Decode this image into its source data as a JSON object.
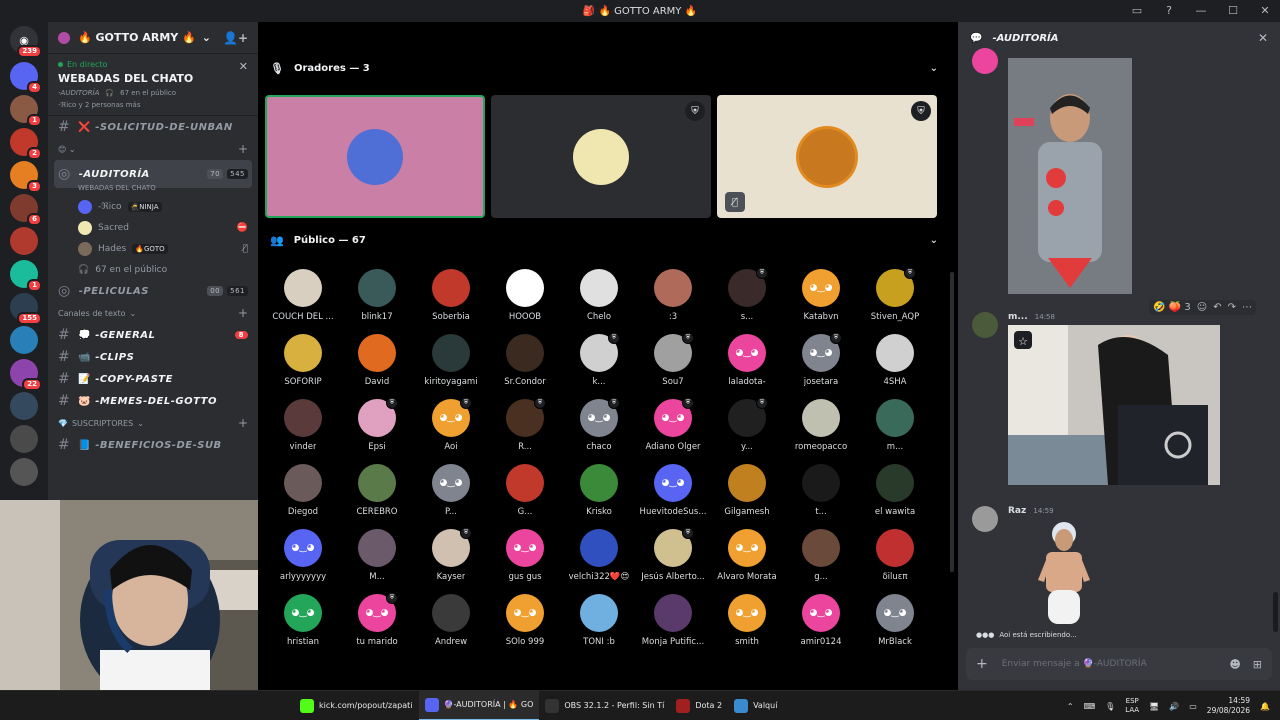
{
  "window": {
    "title": "🎒 🔥 GOTTO ARMY 🔥"
  },
  "rail": {
    "home_badge": "239",
    "servers": [
      {
        "color": "#5865f2",
        "badge": "4"
      },
      {
        "color": "#8a5a44",
        "badge": "1"
      },
      {
        "color": "#c0392b",
        "badge": "2"
      },
      {
        "color": "#e67e22",
        "badge": "3"
      },
      {
        "color": "#7f3b2e",
        "badge": "6"
      },
      {
        "color": "#b03a2e",
        "badge": ""
      },
      {
        "color": "#1abc9c",
        "badge": "1"
      },
      {
        "color": "#2c3e50",
        "badge": "155"
      },
      {
        "color": "#2980b9",
        "badge": ""
      },
      {
        "color": "#8e44ad",
        "badge": "22"
      },
      {
        "color": "#34495e",
        "badge": ""
      },
      {
        "color": "#4a4a4a",
        "badge": ""
      },
      {
        "color": "#555555",
        "badge": ""
      }
    ]
  },
  "sidebar": {
    "guild_name": "🔥 GOTTO ARMY 🔥",
    "live": {
      "status": "En directo",
      "title": "WEBADAS DEL CHATO",
      "channel": "-AUDITORÍA",
      "listeners": "67 en el público",
      "speakers": "-ℜico y 2 personas más"
    },
    "channels_top": [
      {
        "name": "-SOLICITUD-DE-UNBAN",
        "emoji": "❌"
      }
    ],
    "stage_channel": {
      "name": "-AUDITORÍA",
      "subtitle": "WEBADAS DEL CHATO",
      "count_a": "70",
      "count_b": "545"
    },
    "voice_users": [
      {
        "name": "-ℜico",
        "tag": "🥷NINJA",
        "color": "#5865f2"
      },
      {
        "name": "Sacred",
        "tag": "",
        "color": "#f0e6b0"
      },
      {
        "name": "Hades",
        "tag": "🔥GOTO",
        "color": "#7a6a5a"
      },
      {
        "name": "67 en el público",
        "tag": "",
        "color": ""
      }
    ],
    "channel_peliculas": {
      "name": "-PELICULAS",
      "count_a": "00",
      "count_b": "561"
    },
    "text_category": "Canales de texto",
    "text_channels": [
      {
        "name": "-GENERAL",
        "emoji": "💭",
        "badge": "8"
      },
      {
        "name": "-CLIPS",
        "emoji": "📹",
        "badge": ""
      },
      {
        "name": "-COPY-PASTE",
        "emoji": "📝",
        "badge": ""
      },
      {
        "name": "-MEMES-DEL-GOTTO",
        "emoji": "🐷",
        "badge": ""
      }
    ],
    "subs_category": "SUSCRIPTORES",
    "subs_channels": [
      {
        "name": "-BENEFICIOS-DE-SUB",
        "emoji": "📘"
      }
    ]
  },
  "stage": {
    "speakers_header": "Oradores — 3",
    "public_header": "Público — 67",
    "speakers": [
      {
        "bg": "#c97fa6",
        "avatar": "#4f6fd6",
        "shield": false,
        "muted": false,
        "selected": true
      },
      {
        "bg": "#2b2d31",
        "avatar": "#f0e6b0",
        "shield": true,
        "muted": false,
        "selected": false
      },
      {
        "bg": "#e9e1cf",
        "avatar": "#c8781f",
        "shield": true,
        "muted": true,
        "selected": false
      }
    ],
    "audience": [
      {
        "name": "COUCH DEL ...",
        "color": "#d8cfc0",
        "discord": false,
        "badge": false
      },
      {
        "name": "blink17",
        "color": "#3a5a5a",
        "discord": false,
        "badge": false
      },
      {
        "name": "Soberbia",
        "color": "#c0392b",
        "discord": false,
        "badge": false
      },
      {
        "name": "HOOOB",
        "color": "#ffffff",
        "discord": false,
        "badge": false
      },
      {
        "name": "Chelo",
        "color": "#e0e0e0",
        "discord": false,
        "badge": false
      },
      {
        "name": ":3",
        "color": "#b06a5a",
        "discord": false,
        "badge": false
      },
      {
        "name": "s...",
        "color": "#3a2a2a",
        "discord": false,
        "badge": true
      },
      {
        "name": "Katabvn",
        "color": "#f0a030",
        "discord": true,
        "badge": false
      },
      {
        "name": "Stiven_AQP",
        "color": "#c8a020",
        "discord": false,
        "badge": true
      },
      {
        "name": "SOFORIP",
        "color": "#d8b040",
        "discord": false,
        "badge": false
      },
      {
        "name": "David",
        "color": "#e06a20",
        "discord": false,
        "badge": false
      },
      {
        "name": "kiritoyagami",
        "color": "#2a3a3a",
        "discord": false,
        "badge": false
      },
      {
        "name": "Sr.Condor",
        "color": "#3a2a20",
        "discord": false,
        "badge": false
      },
      {
        "name": "k...",
        "color": "#d0d0d0",
        "discord": false,
        "badge": true
      },
      {
        "name": "Sou7",
        "color": "#a0a0a0",
        "discord": false,
        "badge": true
      },
      {
        "name": "laladota-",
        "color": "#eb459e",
        "discord": true,
        "badge": false
      },
      {
        "name": "josetara",
        "color": "#80848e",
        "discord": true,
        "badge": true
      },
      {
        "name": "4SHA",
        "color": "#d0d0d0",
        "discord": false,
        "badge": false
      },
      {
        "name": "vinder",
        "color": "#5a3a3a",
        "discord": false,
        "badge": false
      },
      {
        "name": "Epsi",
        "color": "#e0a0c0",
        "discord": false,
        "badge": true
      },
      {
        "name": "Aoi",
        "color": "#f0a030",
        "discord": true,
        "badge": true
      },
      {
        "name": "R...",
        "color": "#4a3020",
        "discord": false,
        "badge": true
      },
      {
        "name": "chaco",
        "color": "#80848e",
        "discord": true,
        "badge": true
      },
      {
        "name": "Adiano Olger",
        "color": "#eb459e",
        "discord": true,
        "badge": true
      },
      {
        "name": "y...",
        "color": "#202020",
        "discord": false,
        "badge": true
      },
      {
        "name": "romeopacco",
        "color": "#c0c0b0",
        "discord": false,
        "badge": false
      },
      {
        "name": "m...",
        "color": "#3a6a5a",
        "discord": false,
        "badge": false
      },
      {
        "name": "Diegod",
        "color": "#6a5a5a",
        "discord": false,
        "badge": false
      },
      {
        "name": "CEREBRO",
        "color": "#5a7a4a",
        "discord": false,
        "badge": false
      },
      {
        "name": "P...",
        "color": "#80848e",
        "discord": true,
        "badge": false
      },
      {
        "name": "G...",
        "color": "#c0392b",
        "discord": false,
        "badge": false
      },
      {
        "name": "Krisko",
        "color": "#3a8a3a",
        "discord": false,
        "badge": false
      },
      {
        "name": "HuevitodeSus...",
        "color": "#5865f2",
        "discord": true,
        "badge": false
      },
      {
        "name": "Gilgamesh",
        "color": "#c08020",
        "discord": false,
        "badge": false
      },
      {
        "name": "t...",
        "color": "#1a1a1a",
        "discord": false,
        "badge": false
      },
      {
        "name": "el wawita",
        "color": "#2a3a2a",
        "discord": false,
        "badge": false
      },
      {
        "name": "arlyyyyyyy",
        "color": "#5865f2",
        "discord": true,
        "badge": false
      },
      {
        "name": "M...",
        "color": "#6a5a6a",
        "discord": false,
        "badge": false
      },
      {
        "name": "Kayser",
        "color": "#d0c0b0",
        "discord": false,
        "badge": true
      },
      {
        "name": "gus gus",
        "color": "#eb459e",
        "discord": true,
        "badge": false
      },
      {
        "name": "velchi322❤️😍",
        "color": "#3050c0",
        "discord": false,
        "badge": false
      },
      {
        "name": "Jesús Alberto...",
        "color": "#d0c090",
        "discord": false,
        "badge": true
      },
      {
        "name": "Alvaro Morata",
        "color": "#f0a030",
        "discord": true,
        "badge": false
      },
      {
        "name": "g...",
        "color": "#6a4a3a",
        "discord": false,
        "badge": false
      },
      {
        "name": "δiluεπ",
        "color": "#c03030",
        "discord": false,
        "badge": false
      },
      {
        "name": "hristian",
        "color": "#23a55a",
        "discord": true,
        "badge": false
      },
      {
        "name": "tu marido",
        "color": "#eb459e",
        "discord": true,
        "badge": true
      },
      {
        "name": "Andrew",
        "color": "#3a3a3a",
        "discord": false,
        "badge": false
      },
      {
        "name": "SOlo 999",
        "color": "#f0a030",
        "discord": true,
        "badge": false
      },
      {
        "name": "TONI :b",
        "color": "#70b0e0",
        "discord": false,
        "badge": false
      },
      {
        "name": "Monja Putific...",
        "color": "#5a3a6a",
        "discord": false,
        "badge": false
      },
      {
        "name": "smith",
        "color": "#f0a030",
        "discord": true,
        "badge": false
      },
      {
        "name": "amir0124",
        "color": "#eb459e",
        "discord": true,
        "badge": false
      },
      {
        "name": "MrBlack",
        "color": "#80848e",
        "discord": true,
        "badge": false
      }
    ]
  },
  "chat": {
    "header": "-AUDITORÍA",
    "messages": [
      {
        "author": "m...",
        "time": "14:58"
      },
      {
        "author": "Raz",
        "time": "14:59"
      }
    ],
    "reactions": "🤣 🍑 3",
    "typing": "Aoi está escribiendo...",
    "typing_user": "Aoi",
    "input_placeholder": "Enviar mensaje a 🔮-AUDITORÍA"
  },
  "taskbar": {
    "tasks": [
      {
        "label": "kick.com/popout/zapati",
        "icon": "#53fc18",
        "active": false
      },
      {
        "label": "🔮-AUDITORÍA | 🔥 GO",
        "icon": "#5865f2",
        "active": true
      },
      {
        "label": "OBS 32.1.2 - Perfil: Sin Tí",
        "icon": "#333333",
        "active": false
      },
      {
        "label": "Dota 2",
        "icon": "#a02020",
        "active": false
      },
      {
        "label": "Valquí",
        "icon": "#3a8ad0",
        "active": false
      }
    ],
    "lang_top": "ESP",
    "lang_bottom": "LAA",
    "time": "14:59",
    "date": "29/08/2026"
  }
}
